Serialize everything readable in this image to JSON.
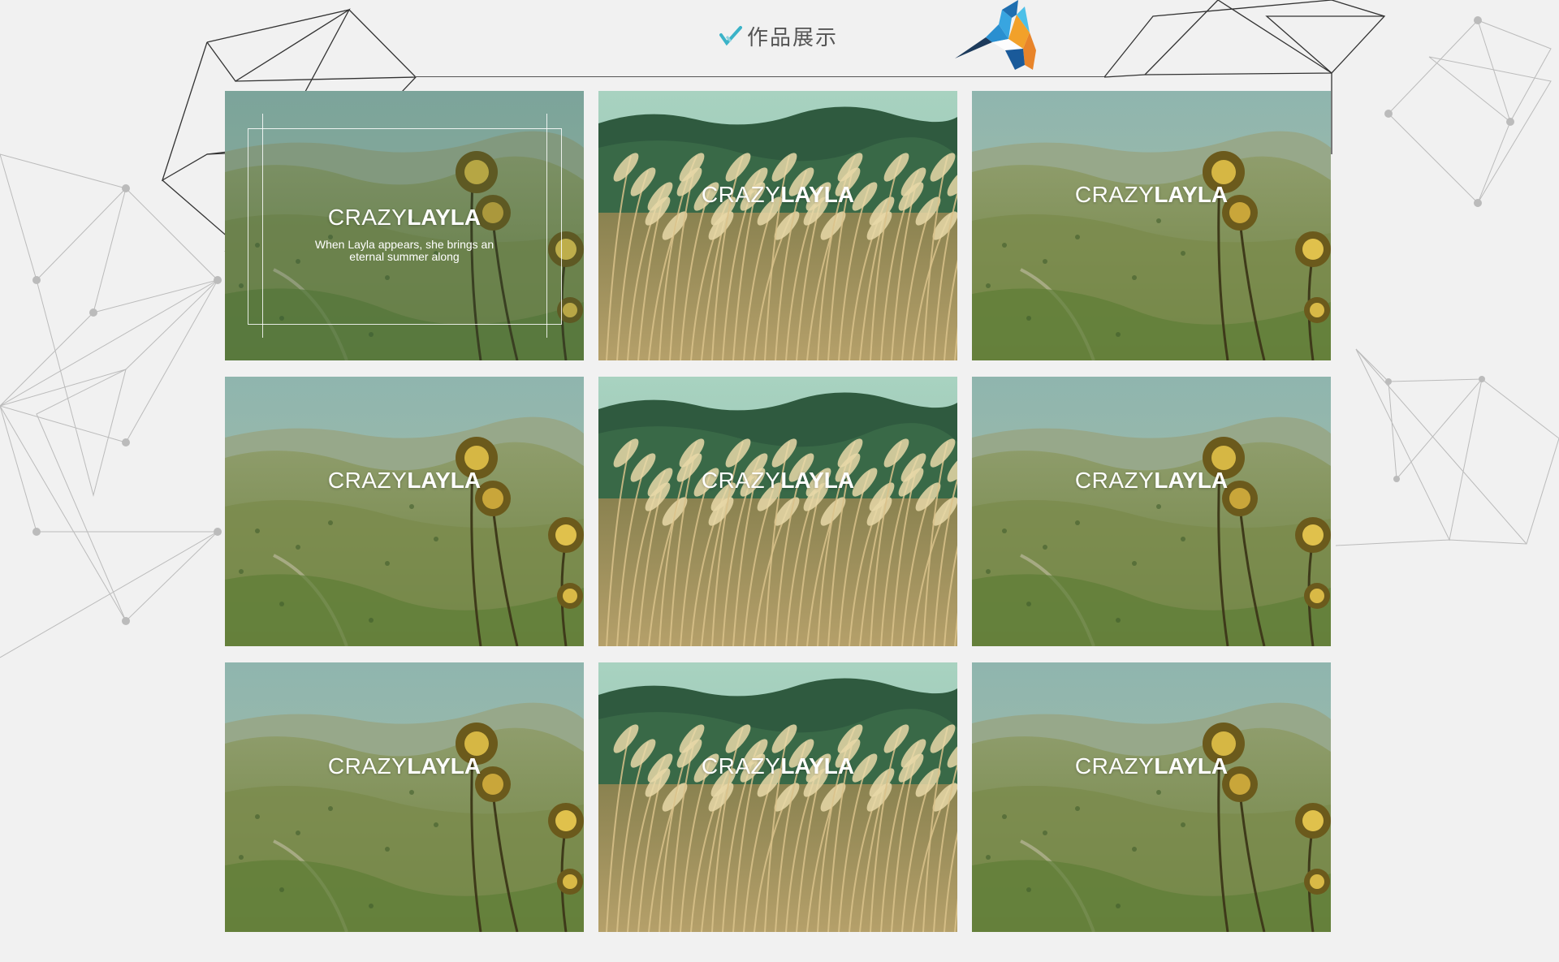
{
  "header": {
    "title": "作品展示",
    "accent_color": "#3bb3c8",
    "logo_icon": "kingfisher-bird-icon"
  },
  "gallery": {
    "items": [
      {
        "scene": "mountain-thistle",
        "brand_light": "CRAZY",
        "brand_bold": "LAYLA",
        "tagline": "When Layla appears, she brings an eternal summer along",
        "hovered": true
      },
      {
        "scene": "wheat-field",
        "brand_light": "CRAZY",
        "brand_bold": "LAYLA"
      },
      {
        "scene": "mountain-thistle",
        "brand_light": "CRAZY",
        "brand_bold": "LAYLA"
      },
      {
        "scene": "mountain-thistle",
        "brand_light": "CRAZY",
        "brand_bold": "LAYLA"
      },
      {
        "scene": "wheat-field",
        "brand_light": "CRAZY",
        "brand_bold": "LAYLA"
      },
      {
        "scene": "mountain-thistle",
        "brand_light": "CRAZY",
        "brand_bold": "LAYLA"
      },
      {
        "scene": "mountain-thistle",
        "brand_light": "CRAZY",
        "brand_bold": "LAYLA"
      },
      {
        "scene": "wheat-field",
        "brand_light": "CRAZY",
        "brand_bold": "LAYLA"
      },
      {
        "scene": "mountain-thistle",
        "brand_light": "CRAZY",
        "brand_bold": "LAYLA"
      }
    ]
  }
}
